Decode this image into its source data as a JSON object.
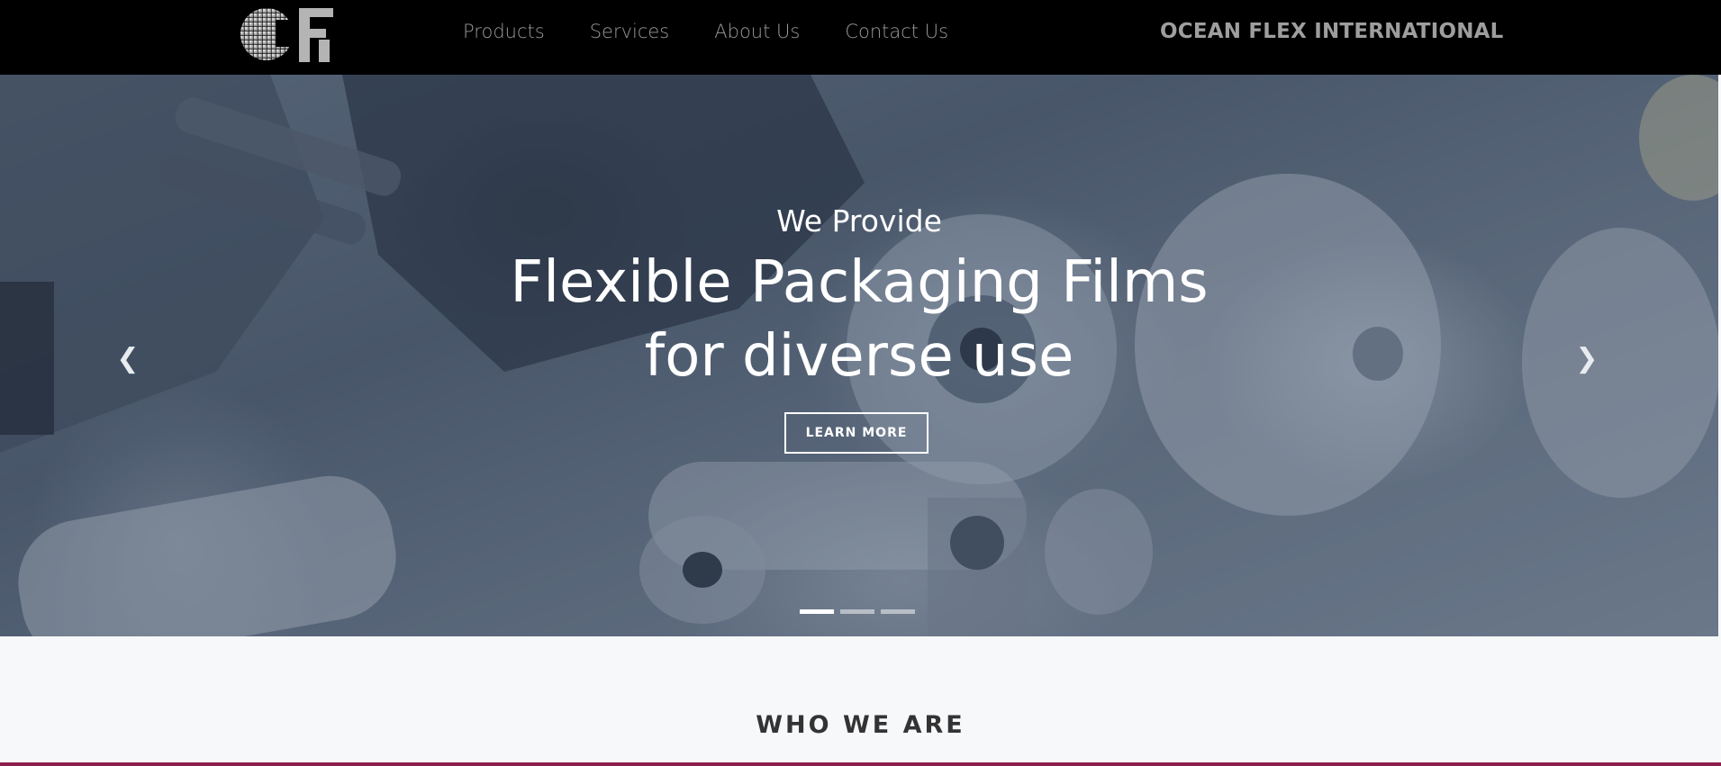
{
  "header": {
    "logo_icon": "ofi-globe-logo",
    "nav": [
      "Products",
      "Services",
      "About Us",
      "Contact Us"
    ],
    "brand": "OCEAN FLEX INTERNATIONAL"
  },
  "hero": {
    "kicker": "We Provide",
    "title_line1": "Flexible Packaging Films",
    "title_line2": "for diverse use",
    "cta_label": "LEARN MORE",
    "prev_icon": "chevron-left-icon",
    "next_icon": "chevron-right-icon",
    "prev_glyph": "❮",
    "next_glyph": "❯",
    "slide_count": 3,
    "active_slide": 1
  },
  "section": {
    "title": "WHO WE ARE"
  },
  "colors": {
    "nav_bg": "#000000",
    "nav_text": "#9a9a9a",
    "accent_line": "#8e1f4d",
    "section_bg": "#f7f8fa"
  }
}
